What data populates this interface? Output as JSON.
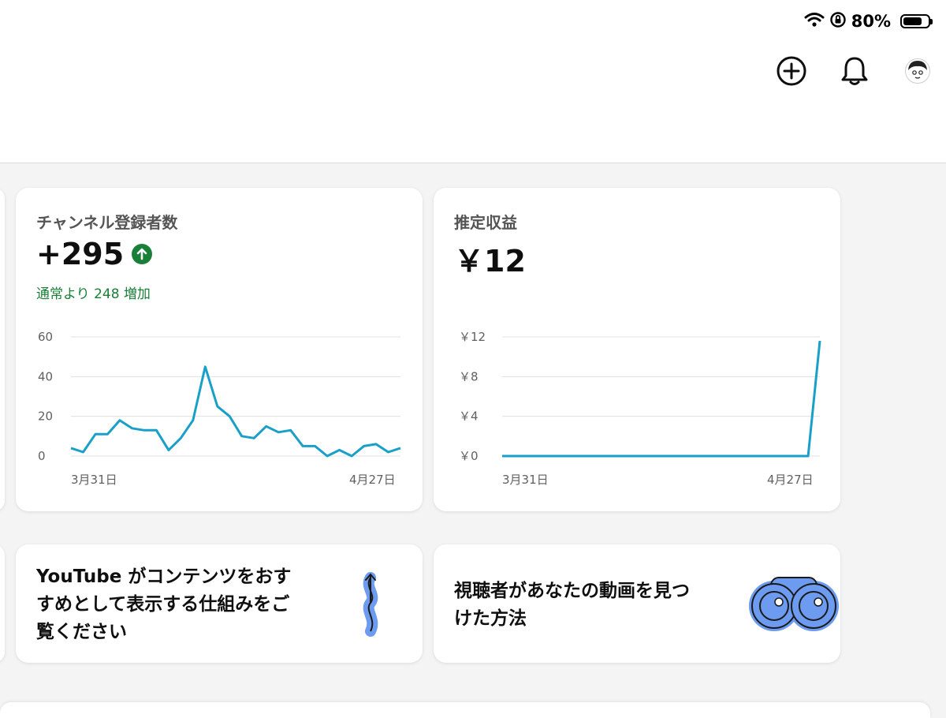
{
  "status_bar": {
    "battery_text": "80%",
    "battery_level": 0.8
  },
  "cards": {
    "subscribers": {
      "title": "チャンネル登録者数",
      "value": "+295",
      "note": "通常より 248 増加"
    },
    "revenue": {
      "title": "推定収益",
      "value": "￥12"
    }
  },
  "promos": {
    "recommend": {
      "lines": [
        "YouTube がコンテンツをおす",
        "すめとして表示する仕組みをご",
        "覧ください"
      ]
    },
    "discovery": {
      "lines": [
        "視聴者があなたの動画を見つ",
        "けた方法"
      ]
    }
  },
  "colors": {
    "line": "#1aa0c8",
    "positive": "#1a7f37",
    "illustration": "#6c9bef"
  },
  "chart_data": [
    {
      "type": "line",
      "title": "チャンネル登録者数",
      "x_tick_labels": [
        "3月31日",
        "4月27日"
      ],
      "y_tick_labels": [
        "0",
        "20",
        "40",
        "60"
      ],
      "ylim": [
        0,
        60
      ],
      "grid": true,
      "series": [
        {
          "values": [
            4,
            2,
            11,
            11,
            18,
            14,
            13,
            13,
            3,
            9,
            18,
            45,
            25,
            20,
            10,
            9,
            15,
            12,
            13,
            5,
            5,
            0,
            3,
            0,
            5,
            6,
            2,
            4
          ]
        }
      ]
    },
    {
      "type": "line",
      "title": "推定収益",
      "x_tick_labels": [
        "3月31日",
        "4月27日"
      ],
      "y_tick_labels": [
        "￥0",
        "￥4",
        "￥8",
        "￥12"
      ],
      "ylim": [
        0,
        12
      ],
      "grid": true,
      "series": [
        {
          "values": [
            0,
            0,
            0,
            0,
            0,
            0,
            0,
            0,
            0,
            0,
            0,
            0,
            0,
            0,
            0,
            0,
            0,
            0,
            0,
            0,
            0,
            0,
            0,
            0,
            0,
            0,
            0,
            11.6
          ]
        }
      ]
    }
  ]
}
